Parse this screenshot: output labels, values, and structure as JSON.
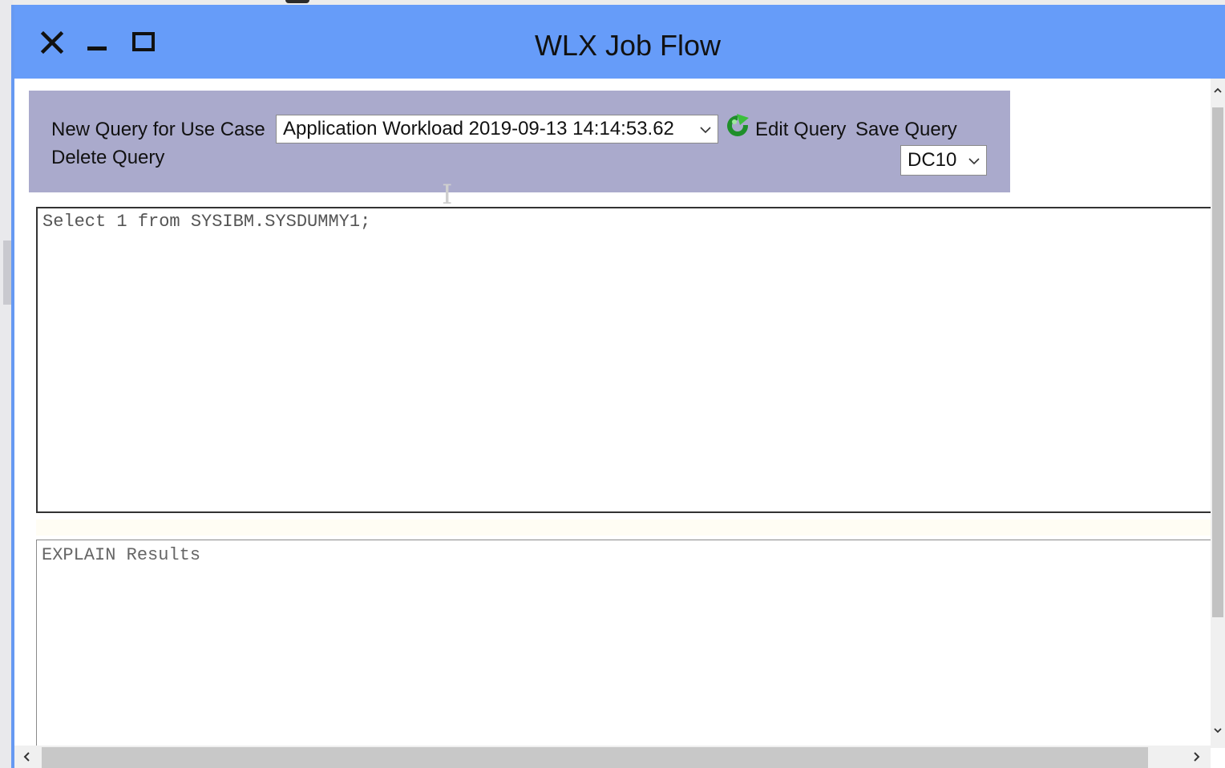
{
  "window": {
    "title": "WLX Job Flow",
    "titlebar_color": "#669cf9"
  },
  "query_panel": {
    "background": "#aaaacc",
    "new_query_label": "New Query for Use Case",
    "use_case_selected": "Application Workload 2019-09-13 14:14:53.62",
    "refresh_icon": "refresh-icon",
    "edit_query_label": "Edit Query",
    "save_query_label": "Save Query",
    "delete_query_label": "Delete Query",
    "subsystem_selected": "DC10"
  },
  "sql_editor": {
    "text": "Select 1 from SYSIBM.SYSDUMMY1;"
  },
  "explain": {
    "placeholder": "EXPLAIN Results"
  }
}
